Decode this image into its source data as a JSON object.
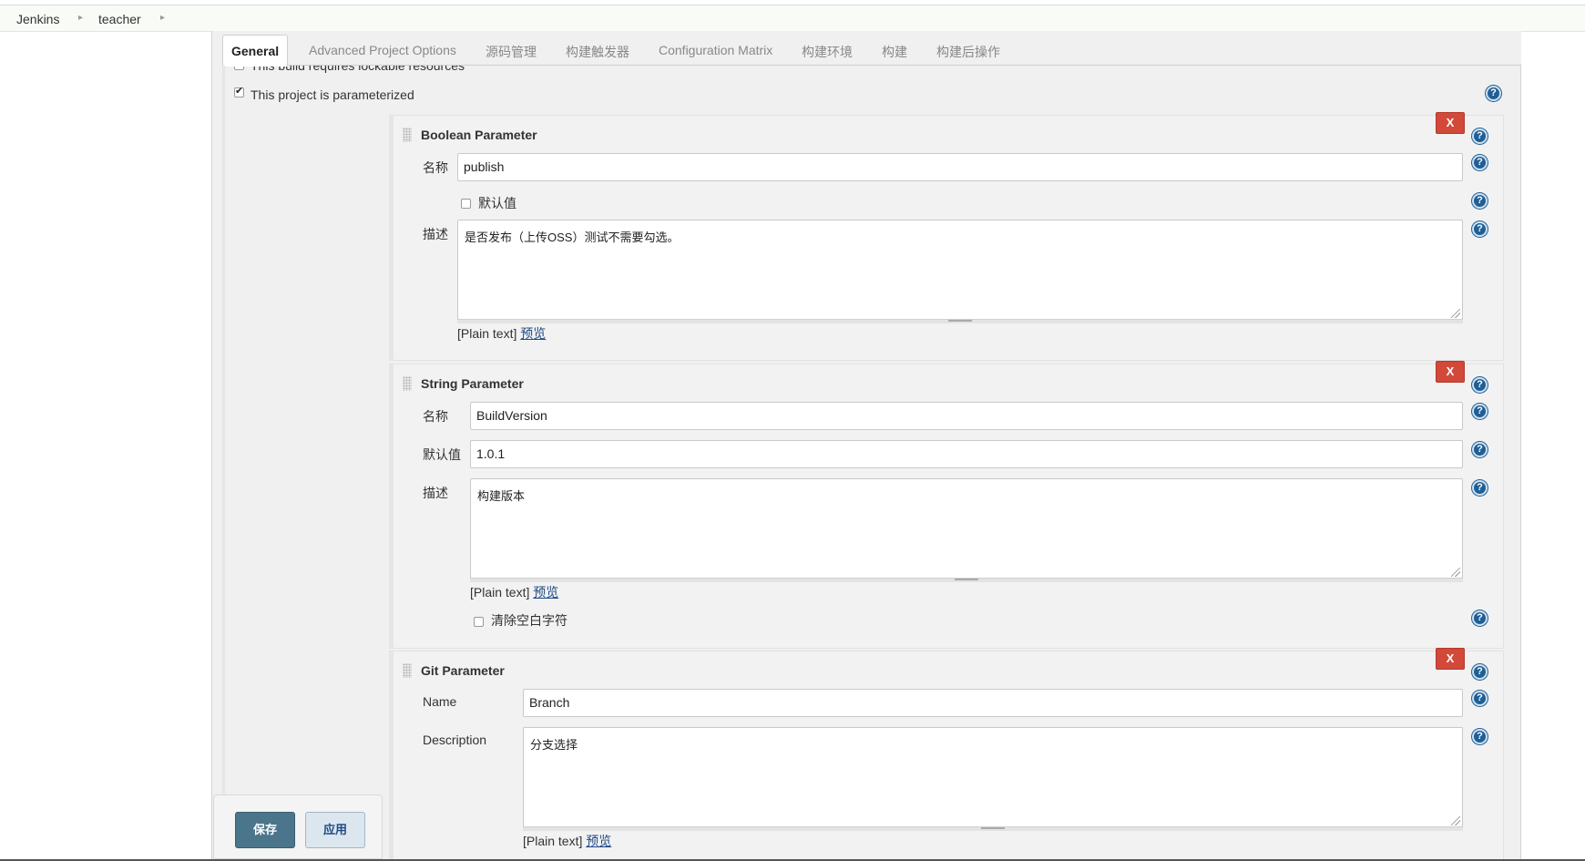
{
  "breadcrumb": {
    "items": [
      "Jenkins",
      "teacher"
    ]
  },
  "tabs": [
    "General",
    "Advanced Project Options",
    "源码管理",
    "构建触发器",
    "Configuration Matrix",
    "构建环境",
    "构建",
    "构建后操作"
  ],
  "general": {
    "lockable_label": "This build requires lockable resources",
    "lockable_checked": false,
    "parameterized_label": "This project is parameterized",
    "parameterized_checked": true
  },
  "help_glyph": "?",
  "delete_label": "X",
  "parameters": {
    "boolean": {
      "title": "Boolean Parameter",
      "name_label": "名称",
      "name_value": "publish",
      "default_label": "默认值",
      "default_checked": false,
      "desc_label": "描述",
      "desc_value": "是否发布（上传OSS）测试不需要勾选。",
      "format_note": "[Plain text]",
      "preview_link": "预览"
    },
    "string": {
      "title": "String Parameter",
      "name_label": "名称",
      "name_value": "BuildVersion",
      "default_label": "默认值",
      "default_value": "1.0.1",
      "desc_label": "描述",
      "desc_value": "构建版本",
      "format_note": "[Plain text]",
      "preview_link": "预览",
      "trim_label": "清除空白字符",
      "trim_checked": false
    },
    "git": {
      "title": "Git Parameter",
      "name_label": "Name",
      "name_value": "Branch",
      "desc_label": "Description",
      "desc_value": "分支选择",
      "format_note": "[Plain text]",
      "preview_link": "预览"
    }
  },
  "buttons": {
    "save": "保存",
    "apply": "应用"
  },
  "colors": {
    "delete": "#d24939",
    "save": "#4b758b",
    "apply": "#dbe6ef",
    "help": "#1f5f96",
    "link": "#204a87"
  }
}
